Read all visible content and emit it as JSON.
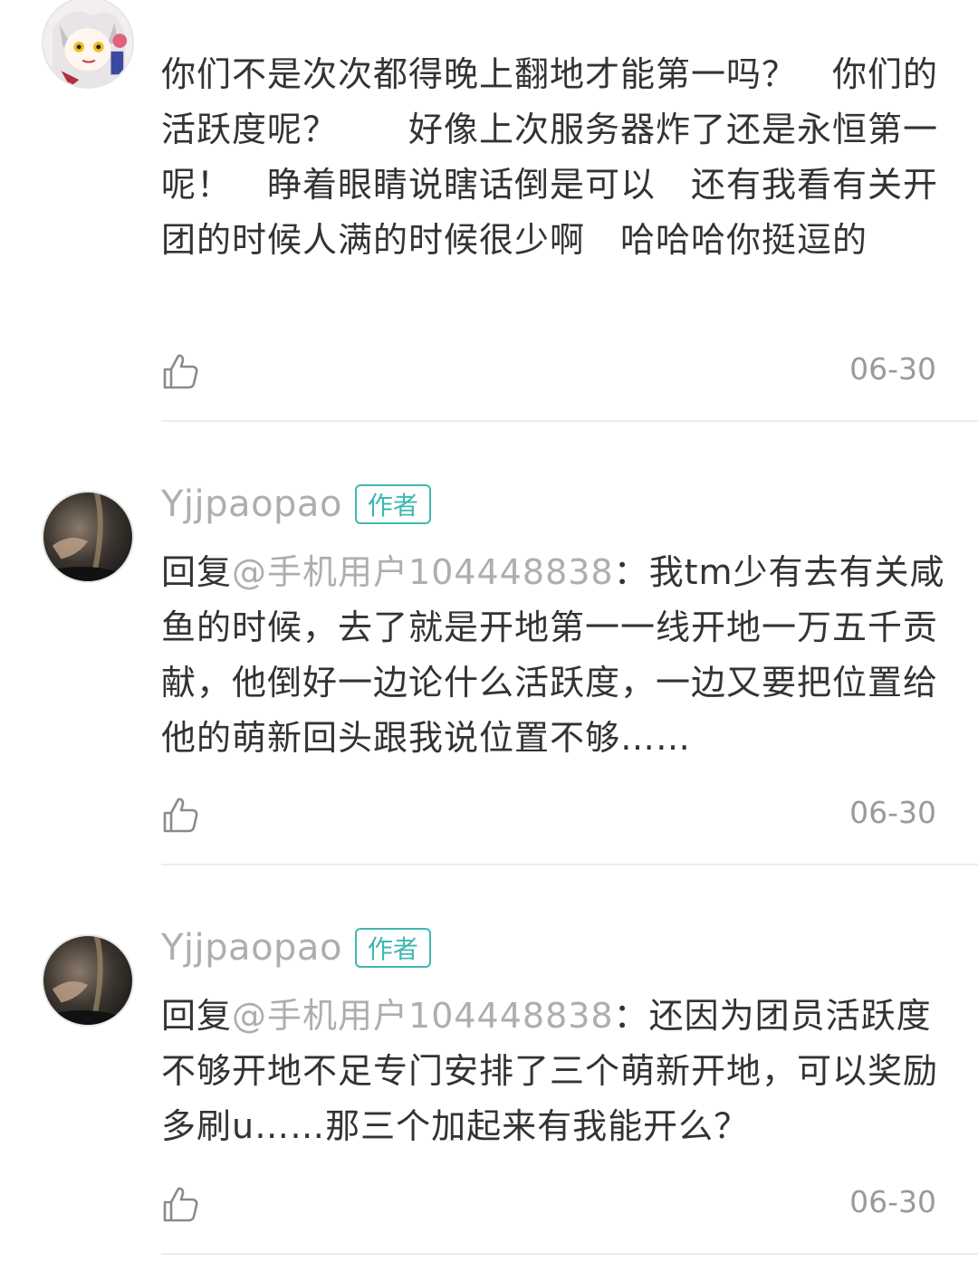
{
  "comments": [
    {
      "author": "",
      "text": "你们不是次次都得晚上翻地才能第一吗？　你们的活跃度呢？　　好像上次服务器炸了还是永恒第一呢！　睁着眼睛说瞎话倒是可以　还有我看有关开团的时候人满的时候很少啊　哈哈哈你挺逗的",
      "date": "06-30"
    },
    {
      "author": "Yjjpaopao",
      "tag": "作者",
      "reply_prefix": "回复",
      "reply_target": "@手机用户104448838",
      "reply_sep": "：",
      "text": "我tm少有去有关咸鱼的时候，去了就是开地第一一线开地一万五千贡献，他倒好一边论什么活跃度，一边又要把位置给他的萌新回头跟我说位置不够……",
      "date": "06-30"
    },
    {
      "author": "Yjjpaopao",
      "tag": "作者",
      "reply_prefix": "回复",
      "reply_target": "@手机用户104448838",
      "reply_sep": "：",
      "text": "还因为团员活跃度不够开地不足专门安排了三个萌新开地，可以奖励多刷u……那三个加起来有我能开么？",
      "date": "06-30"
    }
  ],
  "colors": {
    "accent": "#3fb7b0",
    "text": "#333333",
    "muted": "#aeaeae"
  }
}
